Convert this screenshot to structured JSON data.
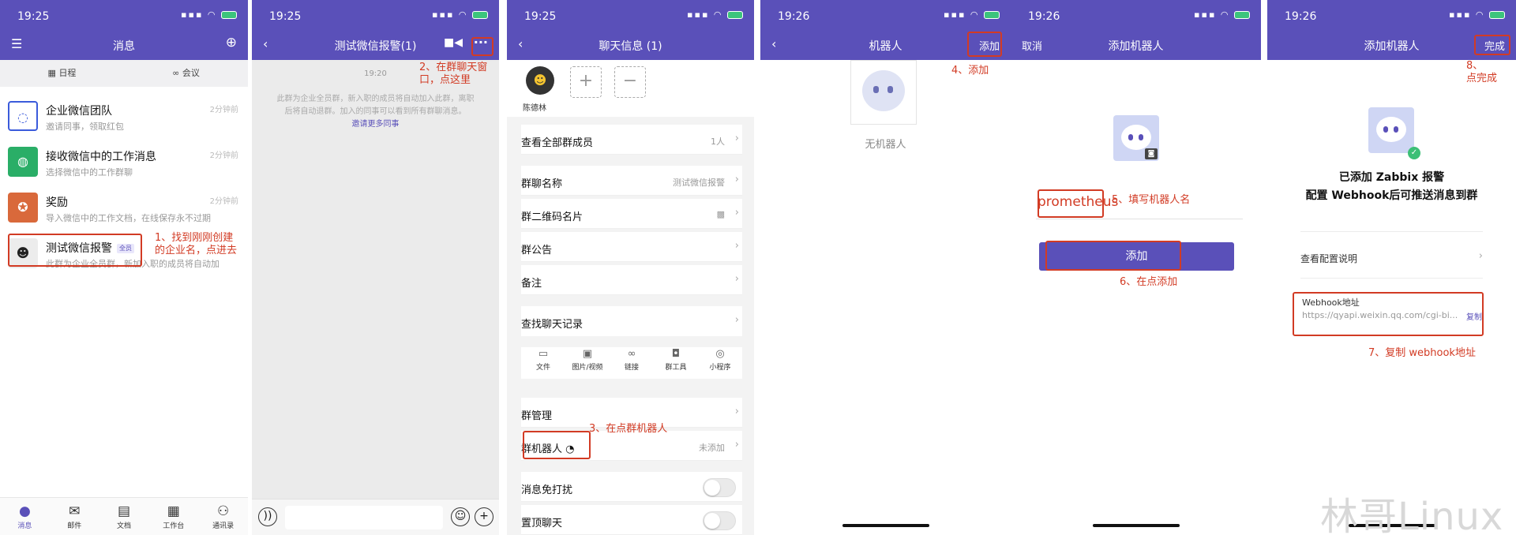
{
  "colors": {
    "accent": "#5a50b9",
    "annotation": "#d23b24",
    "success": "#3cbf76"
  },
  "panel1": {
    "time": "19:25",
    "title": "消息",
    "menu_icon": "menu-icon",
    "add_icon": "plus-circle-icon",
    "segments": [
      {
        "label": "日程",
        "icon": "calendar-icon"
      },
      {
        "label": "会议",
        "icon": "meeting-icon"
      }
    ],
    "conversations": [
      {
        "name": "企业微信团队",
        "sub": "邀请同事，领取红包",
        "time": "2分钟前",
        "icon": "wecom-team-icon"
      },
      {
        "name": "接收微信中的工作消息",
        "sub": "选择微信中的工作群聊",
        "time": "2分钟前",
        "icon": "wechat-icon"
      },
      {
        "name": "奖励",
        "sub": "导入微信中的工作文档，在线保存永不过期",
        "time": "2分钟前",
        "icon": "reward-icon"
      },
      {
        "name": "测试微信报警",
        "tag": "全员",
        "sub": "此群为企业全员群，新加入职的成员将自动加",
        "icon": "group-avatar-icon"
      }
    ],
    "note": "1、找到刚刚创建\n的企业名，点进去",
    "tabs": [
      {
        "label": "消息",
        "icon": "chat-bubble-icon"
      },
      {
        "label": "邮件",
        "icon": "mail-icon"
      },
      {
        "label": "文档",
        "icon": "document-icon"
      },
      {
        "label": "工作台",
        "icon": "workbench-icon"
      },
      {
        "label": "通讯录",
        "icon": "contacts-icon"
      }
    ]
  },
  "panel2": {
    "time": "19:25",
    "title": "测试微信报警(1)",
    "chat_time": "19:20",
    "system_message": "此群为企业全员群，新入职的成员将自动加入此群，离职后将自动退群。加入的同事可以看到所有群聊消息。",
    "invite_link": "邀请更多同事",
    "note": "2、在群聊天窗\n口，点这里",
    "more_icon": "more-dots-icon",
    "video_icon": "video-camera-icon"
  },
  "panel3": {
    "time": "19:25",
    "title": "聊天信息 (1)",
    "member_name": "陈德林",
    "rows": [
      {
        "label": "查看全部群成员",
        "value": "1人"
      },
      {
        "label": "群聊名称",
        "value": "测试微信报警"
      },
      {
        "label": "群二维码名片",
        "value": ""
      },
      {
        "label": "群公告",
        "value": ""
      },
      {
        "label": "备注",
        "value": ""
      },
      {
        "label": "查找聊天记录",
        "value": ""
      }
    ],
    "tools": [
      {
        "label": "文件",
        "icon": "folder-icon"
      },
      {
        "label": "图片/视频",
        "icon": "image-icon"
      },
      {
        "label": "链接",
        "icon": "link-icon"
      },
      {
        "label": "群工具",
        "icon": "toolbox-icon"
      },
      {
        "label": "小程序",
        "icon": "miniprogram-icon"
      }
    ],
    "manage_label": "群管理",
    "robot_label": "群机器人",
    "robot_value": "未添加",
    "dnd_label": "消息免打扰",
    "pin_label": "置顶聊天",
    "note": "3、在点群机器人"
  },
  "panel4": {
    "time": "19:26",
    "title": "机器人",
    "right_action": "添加",
    "empty_text": "无机器人",
    "note": "4、添加"
  },
  "panel5": {
    "time": "19:26",
    "title": "添加机器人",
    "left_action": "取消",
    "name_value": "prometheus",
    "button_label": "添加",
    "note_name": "5、填写机器人名",
    "note_add": "6、在点添加"
  },
  "panel6": {
    "time": "19:26",
    "title": "添加机器人",
    "right_action": "完成",
    "added_title": "已添加 Zabbix 报警",
    "added_sub": "配置 Webhook后可推送消息到群",
    "config_label": "查看配置说明",
    "webhook_label": "Webhook地址",
    "webhook_url": "https://qyapi.weixin.qq.com/cgi-bi...",
    "copy_label": "复制",
    "note_copy": "7、复制 webhook地址",
    "note_done": "8、\n点完成"
  },
  "watermark": "林哥Linux"
}
